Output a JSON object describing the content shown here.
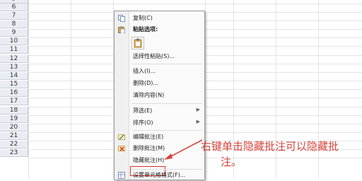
{
  "rows": [
    "5",
    "6",
    "7",
    "8",
    "9",
    "10",
    "11",
    "12",
    "13",
    "14",
    "15",
    "16",
    "17",
    "18",
    "19",
    "20",
    "21",
    "22",
    "23"
  ],
  "menu": {
    "copy": "复制(C)",
    "paste_options": "粘贴选项:",
    "paste_special": "选择性粘贴(S)...",
    "insert": "插入(I)...",
    "delete": "删除(D)...",
    "clear_contents": "清除内容(N)",
    "filter": "筛选(E)",
    "sort": "排序(O)",
    "edit_comment": "编辑批注(E)",
    "delete_comment": "删除批注(M)",
    "hide_comment": "隐藏批注(H)",
    "format_cells": "设置单元格格式(F)..."
  },
  "annotation": {
    "line1": "右键单击隐藏批注可以隐藏批",
    "line2": "注。"
  },
  "colors": {
    "annotation": "#d6443c",
    "highlight_box": "#d9302a"
  }
}
